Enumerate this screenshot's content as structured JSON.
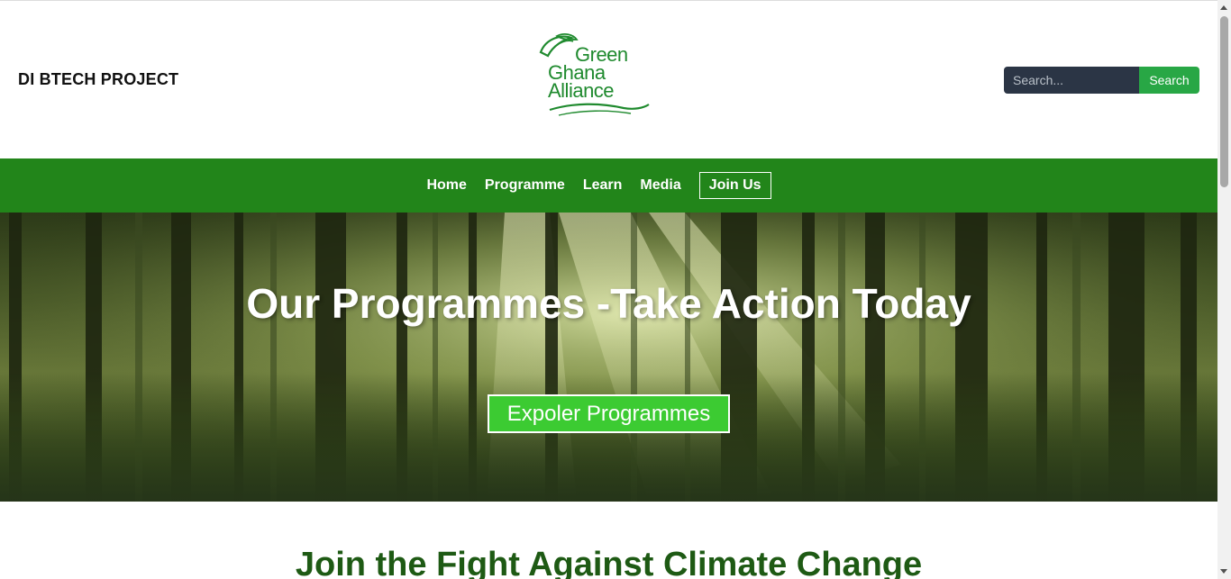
{
  "header": {
    "brand": "DI BTECH PROJECT",
    "logo": {
      "line1": "Green",
      "line2": "Ghana",
      "line3": "Alliance",
      "color": "#1f8a2e"
    },
    "search": {
      "placeholder": "Search...",
      "value": "",
      "button_label": "Search"
    }
  },
  "nav": {
    "items": [
      {
        "label": "Home"
      },
      {
        "label": "Programme"
      },
      {
        "label": "Learn"
      },
      {
        "label": "Media"
      },
      {
        "label": "Join Us"
      }
    ],
    "background": "#22851a"
  },
  "hero": {
    "title": "Our Programmes -Take Action Today",
    "button_label": "Expoler Programmes",
    "button_color": "#3ccb32"
  },
  "section": {
    "title": "Join the Fight Against Climate Change",
    "title_color": "#1e5a14"
  }
}
